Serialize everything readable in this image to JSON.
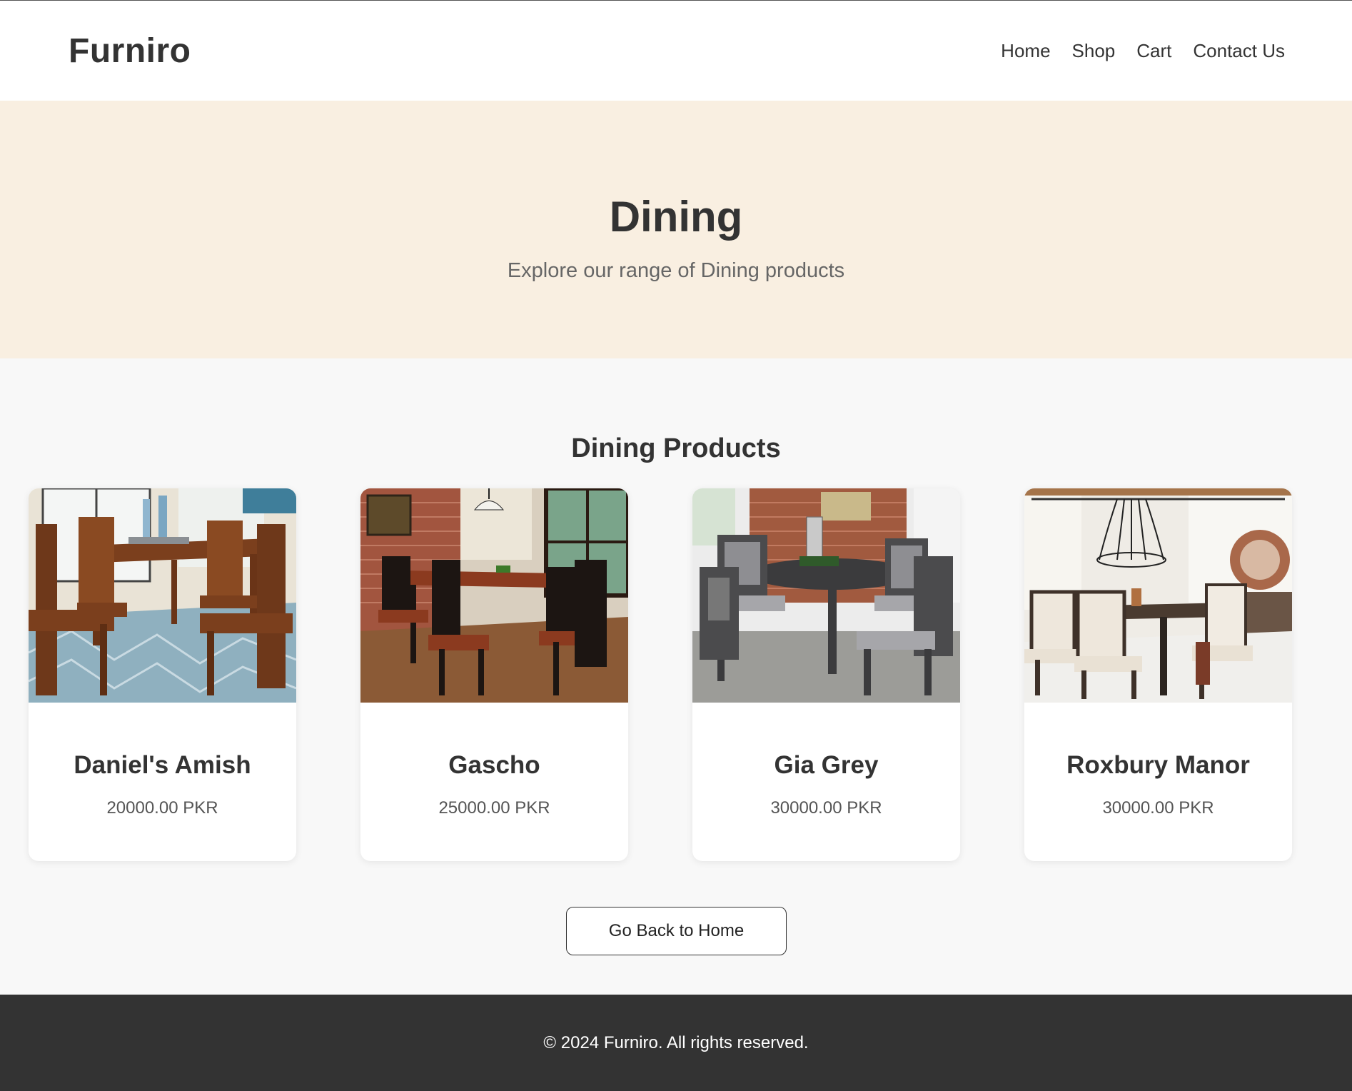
{
  "header": {
    "logo": "Furniro",
    "nav": [
      {
        "label": "Home"
      },
      {
        "label": "Shop"
      },
      {
        "label": "Cart"
      },
      {
        "label": "Contact Us"
      }
    ]
  },
  "hero": {
    "title": "Dining",
    "subtitle": "Explore our range of Dining products"
  },
  "products_section": {
    "title": "Dining Products",
    "items": [
      {
        "name": "Daniel's Amish",
        "price": "20000.00 PKR",
        "image": "photo of walnut dining table with chairs on blue rug"
      },
      {
        "name": "Gascho",
        "price": "25000.00 PKR",
        "image": "photo of dark dining table set by brick wall"
      },
      {
        "name": "Gia Grey",
        "price": "30000.00 PKR",
        "image": "photo of grey round dining table with upholstered chairs"
      },
      {
        "name": "Roxbury Manor",
        "price": "30000.00 PKR",
        "image": "photo of rustic dining table with cream chairs and chandelier"
      }
    ]
  },
  "actions": {
    "back_home": "Go Back to Home"
  },
  "footer": {
    "text": "© 2024 Furniro. All rights reserved."
  },
  "colors": {
    "hero_bg": "#f9efe1",
    "page_bg": "#f8f8f8",
    "footer_bg": "#333333",
    "text_dark": "#333333"
  }
}
